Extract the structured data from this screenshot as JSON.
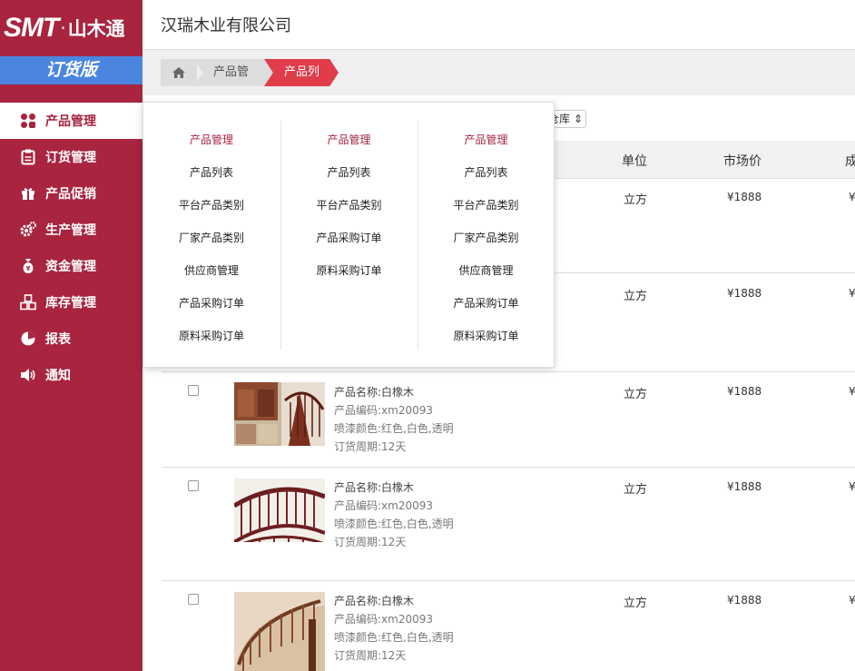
{
  "sidebar": {
    "logo_text": "SMT",
    "logo_dot": "·",
    "logo_cn": "山木通",
    "version": "订货版",
    "items": [
      {
        "label": "产品管理",
        "icon": "grid-icon",
        "active": true
      },
      {
        "label": "订货管理",
        "icon": "clipboard-icon"
      },
      {
        "label": "产品促销",
        "icon": "gift-icon"
      },
      {
        "label": "生产管理",
        "icon": "gears-icon"
      },
      {
        "label": "资金管理",
        "icon": "money-bag-icon"
      },
      {
        "label": "库存管理",
        "icon": "cubes-icon"
      },
      {
        "label": "报表",
        "icon": "pie-chart-icon"
      },
      {
        "label": "通知",
        "icon": "speaker-icon"
      }
    ]
  },
  "header": {
    "company": "汉瑞木业有限公司"
  },
  "breadcrumb": {
    "home_icon": "home-icon",
    "items": [
      "产品管理",
      "产品列表"
    ]
  },
  "filter": {
    "warehouse_label": "仓库 ⇕"
  },
  "table": {
    "columns": [
      "单位",
      "市场价",
      "成"
    ],
    "rows": [
      {
        "unit": "立方",
        "price": "¥1888",
        "cut": "¥"
      },
      {
        "unit": "立方",
        "price": "¥1888",
        "cut": "¥"
      },
      {
        "name": "产品名称:白橡木",
        "code": "产品编码:xm20093",
        "color": "喷漆颜色:红色,白色,透明",
        "period": "订货周期:12天",
        "unit": "立方",
        "price": "¥1888",
        "cut": "¥"
      },
      {
        "name": "产品名称:白橡木",
        "code": "产品编码:xm20093",
        "color": "喷漆颜色:红色,白色,透明",
        "period": "订货周期:12天",
        "unit": "立方",
        "price": "¥1888",
        "cut": "¥"
      },
      {
        "name": "产品名称:白橡木",
        "code": "产品编码:xm20093",
        "color": "喷漆颜色:红色,白色,透明",
        "period": "订货周期:12天",
        "unit": "立方",
        "price": "¥1888",
        "cut": "¥"
      }
    ]
  },
  "dropdown": {
    "columns": [
      {
        "title": "产品管理",
        "links": [
          "产品列表",
          "平台产品类别",
          "厂家产品类别",
          "供应商管理",
          "产品采购订单",
          "原料采购订单"
        ]
      },
      {
        "title": "产品管理",
        "links": [
          "产品列表",
          "平台产品类别",
          "产品采购订单",
          "原料采购订单"
        ]
      },
      {
        "title": "产品管理",
        "links": [
          "产品列表",
          "平台产品类别",
          "厂家产品类别",
          "供应商管理",
          "产品采购订单",
          "原料采购订单"
        ]
      }
    ]
  },
  "colors": {
    "brand": "#a8243f",
    "version_bg": "#4a86e0",
    "crumb_active": "#e03c4a"
  }
}
